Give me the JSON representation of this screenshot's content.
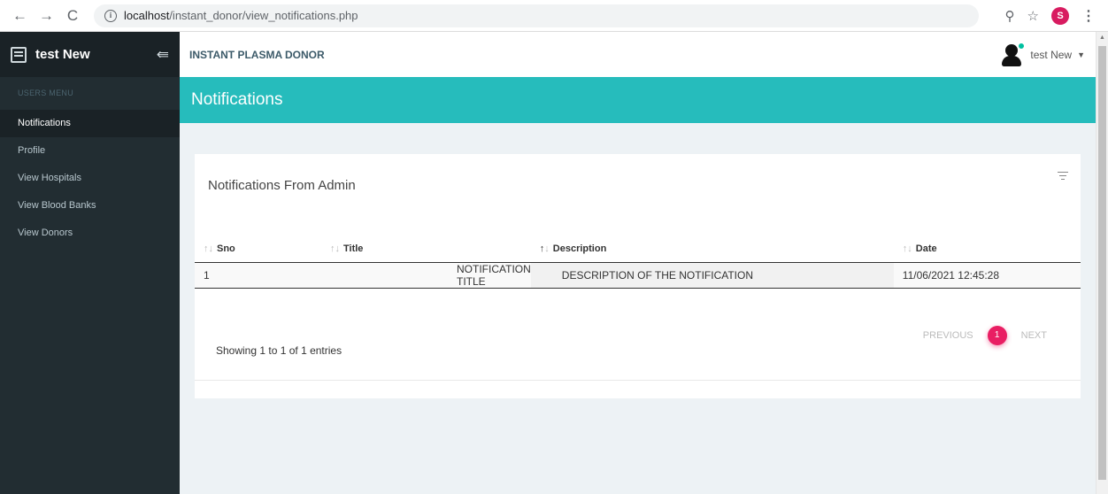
{
  "browser": {
    "url_host": "localhost",
    "url_path": "/instant_donor/view_notifications.php",
    "profile_initial": "S"
  },
  "sidebar": {
    "brand": "test New",
    "menu_header": "USERS MENU",
    "items": [
      {
        "label": "Notifications",
        "active": true
      },
      {
        "label": "Profile"
      },
      {
        "label": "View Hospitals"
      },
      {
        "label": "View Blood Banks"
      },
      {
        "label": "View Donors"
      }
    ]
  },
  "topbar": {
    "app_name": "INSTANT PLASMA DONOR",
    "user_name": "test New"
  },
  "page": {
    "title": "Notifications"
  },
  "card": {
    "title": "Notifications From Admin",
    "columns": [
      "Sno",
      "Title",
      "Description",
      "Date"
    ],
    "rows": [
      {
        "sno": "1",
        "title": "NOTIFICATION TITLE",
        "description": "DESCRIPTION OF THE NOTIFICATION",
        "date": "11/06/2021 12:45:28"
      }
    ],
    "info": "Showing 1 to 1 of 1 entries",
    "pagination": {
      "previous": "PREVIOUS",
      "current": "1",
      "next": "NEXT"
    }
  },
  "colors": {
    "sidebar_bg": "#222d32",
    "header_accent": "#26bcbc",
    "page_active": "#e91e63"
  }
}
